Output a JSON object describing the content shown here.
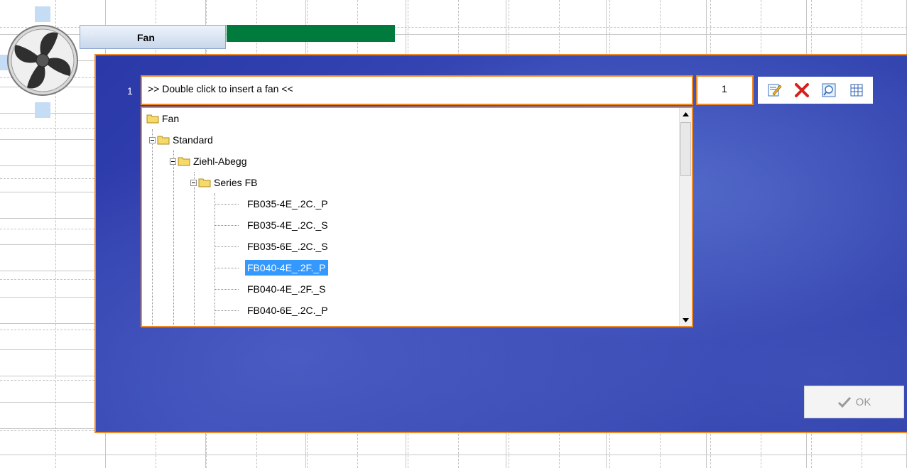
{
  "title_tab": {
    "ghost_text": "Fan",
    "label": "Fan"
  },
  "row": {
    "number": "1",
    "input_value": ">> Double click to insert a fan <<",
    "quantity": "1"
  },
  "toolbar": {
    "icons": [
      "edit-icon",
      "delete-icon",
      "search-icon",
      "grid-icon"
    ]
  },
  "tree": {
    "root": "Fan",
    "level1": "Standard",
    "level2": "Ziehl-Abegg",
    "level3": "Series FB",
    "items": [
      "FB035-4E_.2C._P",
      "FB035-4E_.2C._S",
      "FB035-6E_.2C._S",
      "FB040-4E_.2F._P",
      "FB040-4E_.2F._S",
      "FB040-6E_.2C._P"
    ],
    "selected_item": "FB040-4E_.2F._P"
  },
  "ok_button": {
    "label": "OK"
  },
  "colors": {
    "panel_blue": "#3445b0",
    "accent_orange": "#f08a24",
    "progress_green": "#007a3d",
    "selection": "#3399ff"
  }
}
